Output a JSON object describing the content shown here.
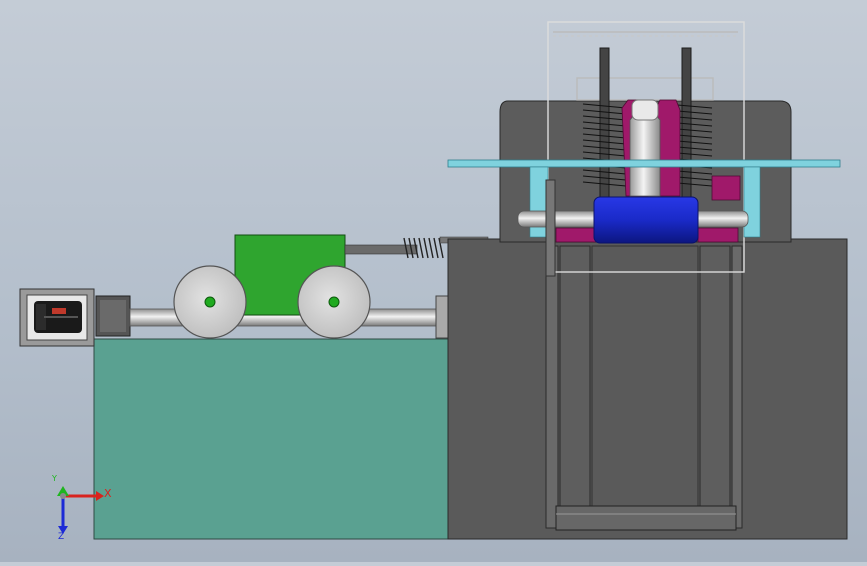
{
  "viewport": {
    "background_top": "#c4ccd6",
    "background_bottom": "#a7b2c0"
  },
  "colors": {
    "base_teal": "#5aa191",
    "machine_gray": "#5a5a5a",
    "carriage_green": "#2fa52f",
    "roller_blue": "#1c2fd0",
    "plate_cyan": "#7fd2de",
    "accent_magenta": "#a0196a",
    "wheel_gray": "#d2d2d2"
  },
  "triad": {
    "x_label": "X",
    "y_label": "Y",
    "z_label": "Z",
    "x_color": "#d8231e",
    "y_color": "#1fb51f",
    "z_color": "#1c2ad6"
  }
}
